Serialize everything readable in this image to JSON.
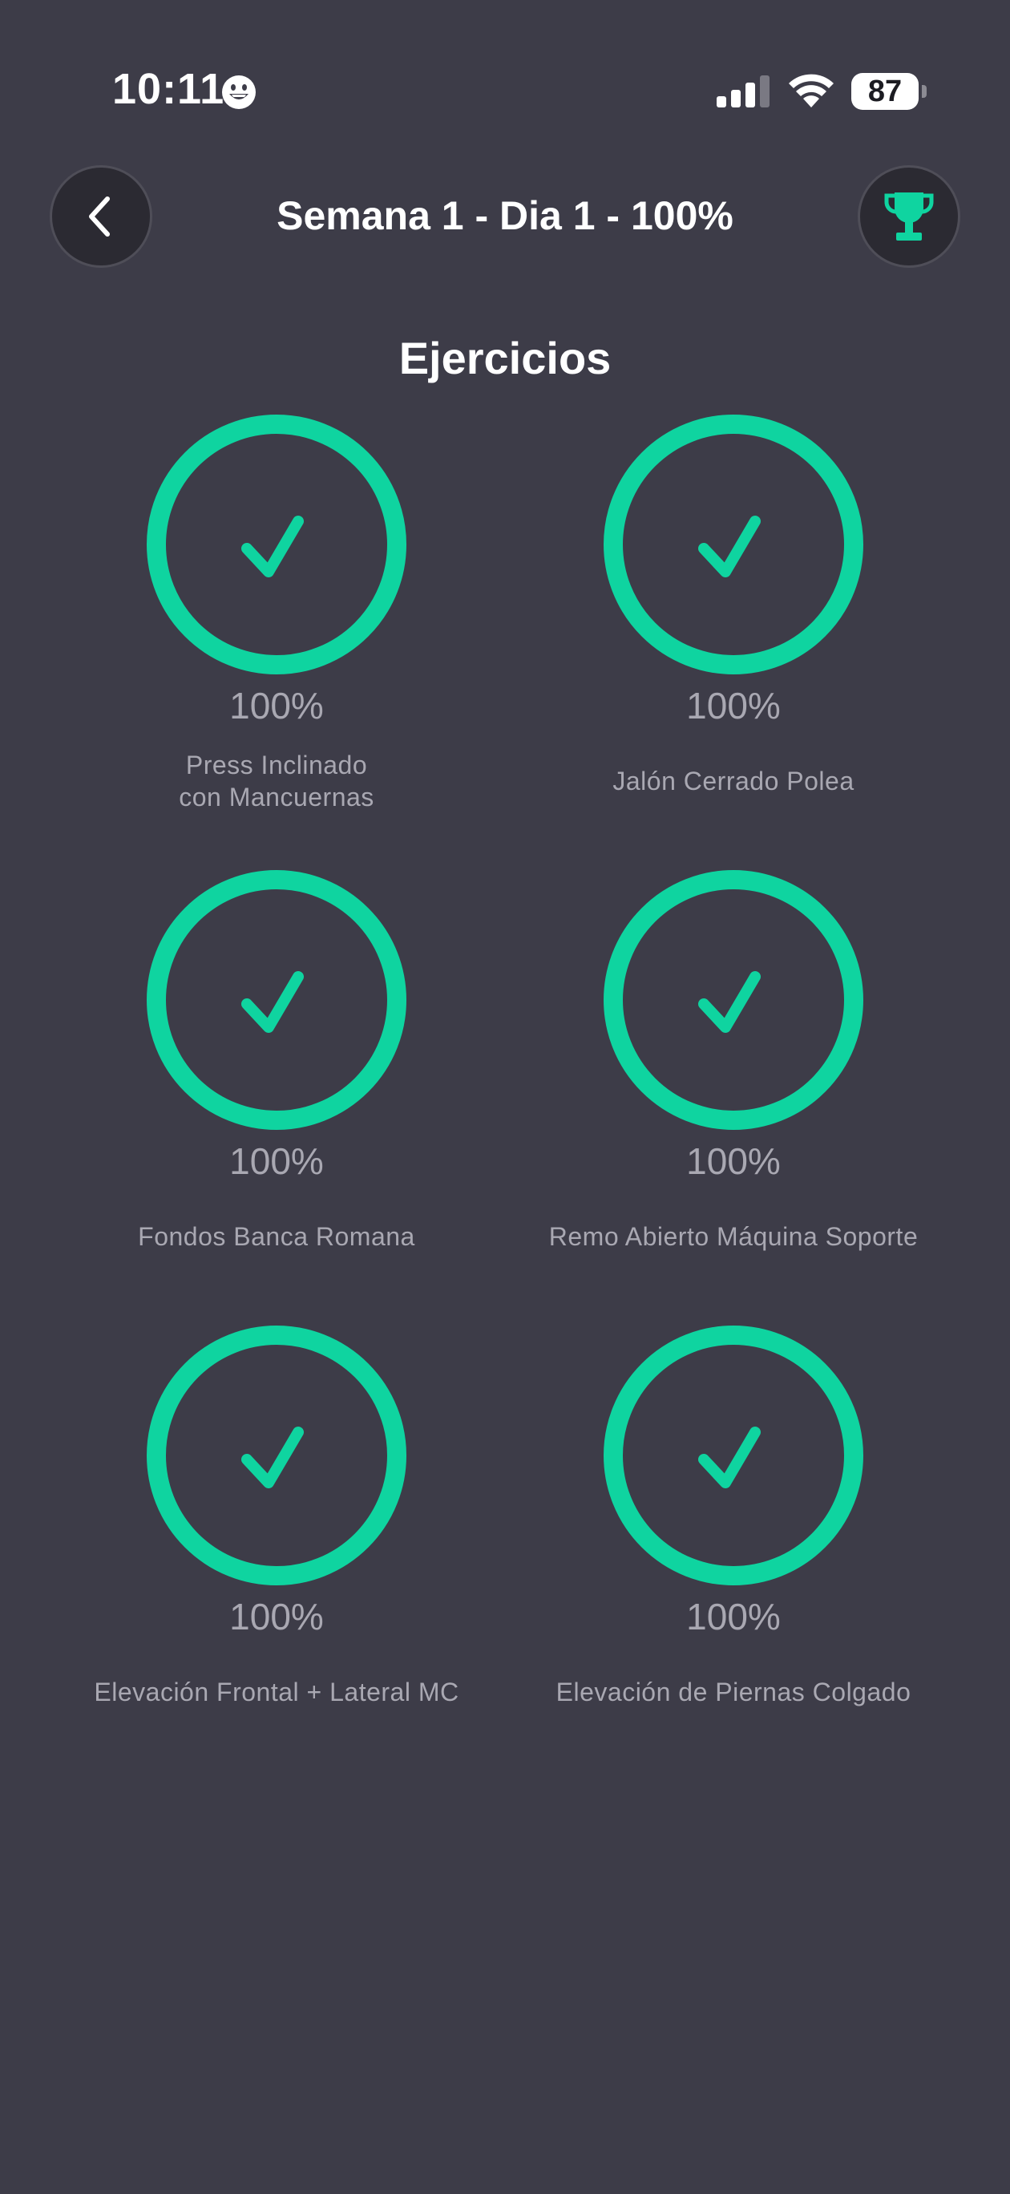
{
  "status_bar": {
    "time": "10:11",
    "battery": "87",
    "icons": [
      "emoji-face-icon",
      "cellular-signal-icon",
      "wifi-icon",
      "battery-icon"
    ]
  },
  "header": {
    "title": "Semana 1 - Dia 1 - 100%",
    "back_icon": "chevron-left-icon",
    "trophy_icon": "trophy-icon"
  },
  "section": {
    "title": "Ejercicios"
  },
  "exercises": [
    {
      "name": "Press Inclinado\ncon Mancuernas",
      "percent": "100%",
      "progress": 1.0,
      "status_icon": "checkmark-icon"
    },
    {
      "name": "Jalón Cerrado Polea",
      "percent": "100%",
      "progress": 1.0,
      "status_icon": "checkmark-icon"
    },
    {
      "name": "Fondos Banca Romana",
      "percent": "100%",
      "progress": 1.0,
      "status_icon": "checkmark-icon"
    },
    {
      "name": "Remo Abierto Máquina Soporte",
      "percent": "100%",
      "progress": 1.0,
      "status_icon": "checkmark-icon"
    },
    {
      "name": "Elevación Frontal + Lateral MC",
      "percent": "100%",
      "progress": 1.0,
      "status_icon": "checkmark-icon"
    },
    {
      "name": "Elevación de Piernas Colgado",
      "percent": "100%",
      "progress": 1.0,
      "status_icon": "checkmark-icon"
    }
  ],
  "colors": {
    "background": "#3d3c48",
    "accent": "#0fd4a0",
    "muted_text": "#a9a8b2",
    "button_bg": "#2b2a32"
  }
}
